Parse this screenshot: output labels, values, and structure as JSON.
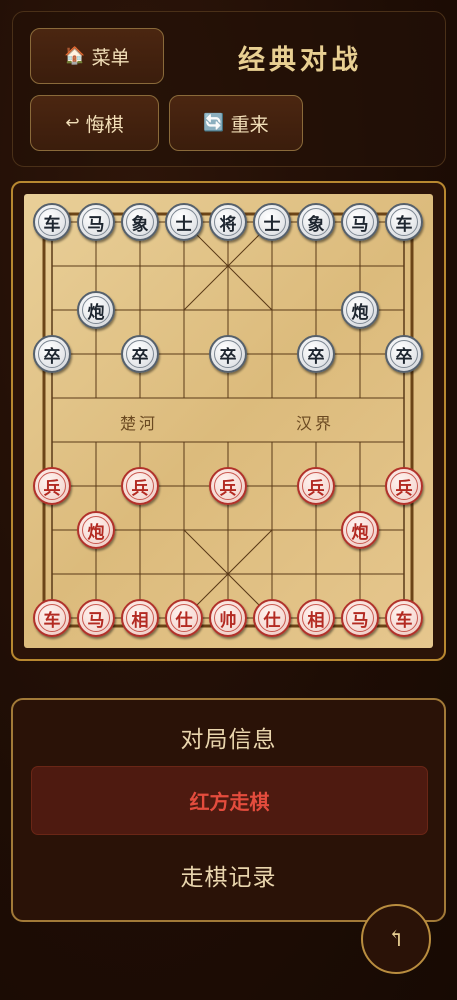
{
  "header": {
    "title": "经典对战",
    "menu_button": {
      "icon": "🏠",
      "label": "菜单"
    },
    "undo_button": {
      "icon": "↩",
      "label": "悔棋"
    },
    "restart_button": {
      "icon": "🔄",
      "label": "重来"
    }
  },
  "board": {
    "river_left": "楚河",
    "river_right": "汉界",
    "pieces": [
      {
        "side": "black",
        "char": "车",
        "file": 0,
        "rank": 0
      },
      {
        "side": "black",
        "char": "马",
        "file": 1,
        "rank": 0
      },
      {
        "side": "black",
        "char": "象",
        "file": 2,
        "rank": 0
      },
      {
        "side": "black",
        "char": "士",
        "file": 3,
        "rank": 0
      },
      {
        "side": "black",
        "char": "将",
        "file": 4,
        "rank": 0
      },
      {
        "side": "black",
        "char": "士",
        "file": 5,
        "rank": 0
      },
      {
        "side": "black",
        "char": "象",
        "file": 6,
        "rank": 0
      },
      {
        "side": "black",
        "char": "马",
        "file": 7,
        "rank": 0
      },
      {
        "side": "black",
        "char": "车",
        "file": 8,
        "rank": 0
      },
      {
        "side": "black",
        "char": "炮",
        "file": 1,
        "rank": 2
      },
      {
        "side": "black",
        "char": "炮",
        "file": 7,
        "rank": 2
      },
      {
        "side": "black",
        "char": "卒",
        "file": 0,
        "rank": 3
      },
      {
        "side": "black",
        "char": "卒",
        "file": 2,
        "rank": 3
      },
      {
        "side": "black",
        "char": "卒",
        "file": 4,
        "rank": 3
      },
      {
        "side": "black",
        "char": "卒",
        "file": 6,
        "rank": 3
      },
      {
        "side": "black",
        "char": "卒",
        "file": 8,
        "rank": 3
      },
      {
        "side": "red",
        "char": "兵",
        "file": 0,
        "rank": 6
      },
      {
        "side": "red",
        "char": "兵",
        "file": 2,
        "rank": 6
      },
      {
        "side": "red",
        "char": "兵",
        "file": 4,
        "rank": 6
      },
      {
        "side": "red",
        "char": "兵",
        "file": 6,
        "rank": 6
      },
      {
        "side": "red",
        "char": "兵",
        "file": 8,
        "rank": 6
      },
      {
        "side": "red",
        "char": "炮",
        "file": 1,
        "rank": 7
      },
      {
        "side": "red",
        "char": "炮",
        "file": 7,
        "rank": 7
      },
      {
        "side": "red",
        "char": "车",
        "file": 0,
        "rank": 9
      },
      {
        "side": "red",
        "char": "马",
        "file": 1,
        "rank": 9
      },
      {
        "side": "red",
        "char": "相",
        "file": 2,
        "rank": 9
      },
      {
        "side": "red",
        "char": "仕",
        "file": 3,
        "rank": 9
      },
      {
        "side": "red",
        "char": "帅",
        "file": 4,
        "rank": 9
      },
      {
        "side": "red",
        "char": "仕",
        "file": 5,
        "rank": 9
      },
      {
        "side": "red",
        "char": "相",
        "file": 6,
        "rank": 9
      },
      {
        "side": "red",
        "char": "马",
        "file": 7,
        "rank": 9
      },
      {
        "side": "red",
        "char": "车",
        "file": 8,
        "rank": 9
      }
    ]
  },
  "info": {
    "title": "对局信息",
    "turn": "红方走棋",
    "history_title": "走棋记录"
  },
  "fab": {
    "icon": "↰"
  },
  "colors": {
    "accent": "#b88830",
    "red_turn": "#e44c3d"
  }
}
